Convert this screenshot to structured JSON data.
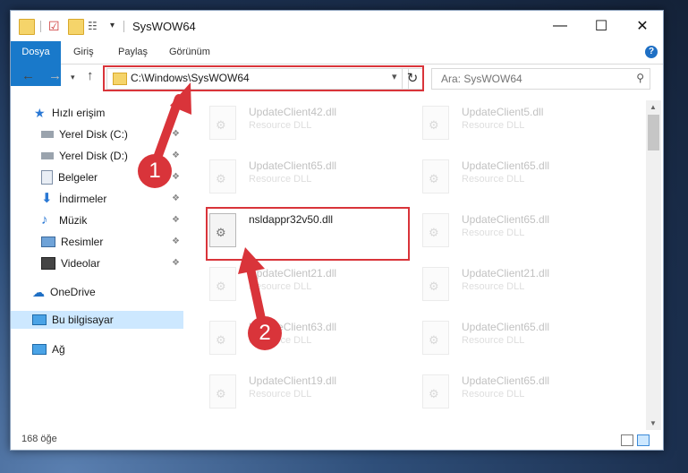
{
  "window": {
    "title": "SysWOW64"
  },
  "ribbon": {
    "tabs": [
      "Dosya",
      "Giriş",
      "Paylaş",
      "Görünüm"
    ]
  },
  "address": {
    "path": "C:\\Windows\\SysWOW64"
  },
  "search": {
    "placeholder": "Ara: SysWOW64"
  },
  "nav": {
    "quick_access": "Hızlı erişim",
    "items": [
      "Yerel Disk (C:)",
      "Yerel Disk (D:)",
      "Belgeler",
      "İndirmeler",
      "Müzik",
      "Resimler",
      "Videolar"
    ],
    "onedrive": "OneDrive",
    "this_pc": "Bu bilgisayar",
    "network": "Ağ"
  },
  "files": {
    "col1": [
      {
        "name": "UpdateClient42.dll",
        "type": "Resource DLL"
      },
      {
        "name": "UpdateClient65.dll",
        "type": "Resource DLL"
      },
      {
        "name": "nsldappr32v50.dll",
        "type": ""
      },
      {
        "name": "UpdateClient21.dll",
        "type": "Resource DLL"
      },
      {
        "name": "UpdateClient63.dll",
        "type": "Resource DLL"
      },
      {
        "name": "UpdateClient19.dll",
        "type": "Resource DLL"
      }
    ],
    "col2": [
      {
        "name": "UpdateClient5.dll",
        "type": "Resource DLL"
      },
      {
        "name": "UpdateClient65.dll",
        "type": "Resource DLL"
      },
      {
        "name": "UpdateClient65.dll",
        "type": "Resource DLL"
      },
      {
        "name": "UpdateClient21.dll",
        "type": "Resource DLL"
      },
      {
        "name": "UpdateClient65.dll",
        "type": "Resource DLL"
      },
      {
        "name": "UpdateClient65.dll",
        "type": "Resource DLL"
      }
    ]
  },
  "status": {
    "count": "168 öğe"
  },
  "annotations": {
    "step1": "1",
    "step2": "2"
  },
  "colors": {
    "accent": "#1979ca",
    "highlight": "#d9343a",
    "selected": "#cde8ff"
  }
}
